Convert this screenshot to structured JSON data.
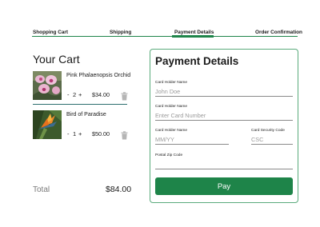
{
  "steps": {
    "items": [
      "Shopping Cart",
      "Shipping",
      "Payment Details",
      "Order Confirmation"
    ],
    "active": "Payment Details",
    "accent": "#1e8449"
  },
  "cart": {
    "title": "Your Cart",
    "items": [
      {
        "name": "Pink Phalaenopsis Orchid",
        "quantity": "2",
        "price": "$34.00",
        "icon": "orchid-photo"
      },
      {
        "name": "Bird of Paradise",
        "quantity": "1",
        "price": "$50.00",
        "icon": "bird-of-paradise-photo"
      }
    ],
    "qty_minus": "-",
    "qty_plus": "+",
    "total_label": "Total",
    "total_value": "$84.00"
  },
  "payment": {
    "title": "Payment Details",
    "fields": {
      "holder_name": {
        "label": "Card Holder Name",
        "placeholder": "John Doe"
      },
      "card_number": {
        "label": "Card Holder Name",
        "placeholder": "Enter Card Number"
      },
      "expiry": {
        "label": "Card Holder Name",
        "placeholder": "MM/YY"
      },
      "csc": {
        "label": "Card Security Code",
        "placeholder": "CSC"
      },
      "zip": {
        "label": "Postal Zip Code",
        "placeholder": ""
      }
    },
    "pay_label": "Pay",
    "pay_color": "#1e8449"
  }
}
